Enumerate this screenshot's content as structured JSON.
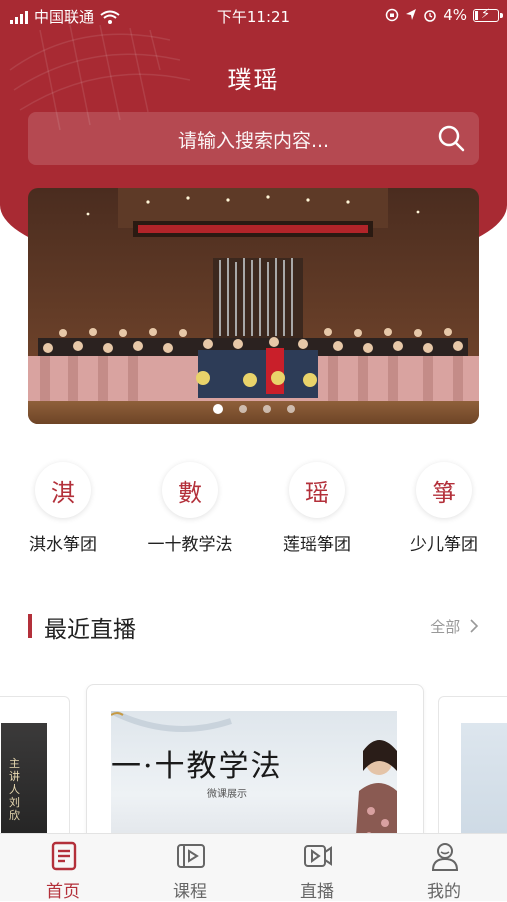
{
  "status_bar": {
    "carrier": "中国联通",
    "time": "下午11:21",
    "battery": "4%"
  },
  "header": {
    "title": "璞瑶"
  },
  "search": {
    "placeholder": "请输入搜索内容..."
  },
  "banner": {
    "slides": 4,
    "active_index": 0
  },
  "categories": [
    {
      "icon_char": "淇",
      "label": "淇水筝团"
    },
    {
      "icon_char": "數",
      "label": "一十教学法"
    },
    {
      "icon_char": "瑶",
      "label": "莲瑶筝团"
    },
    {
      "icon_char": "箏",
      "label": "少儿筝团"
    }
  ],
  "section": {
    "title": "最近直播",
    "more_label": "全部"
  },
  "live_cards": {
    "left_text": "主讲人刘欣",
    "main_title": "一·十教学法",
    "main_sub": "微课展示"
  },
  "tabbar": {
    "items": [
      {
        "label": "首页",
        "active": true
      },
      {
        "label": "课程",
        "active": false
      },
      {
        "label": "直播",
        "active": false
      },
      {
        "label": "我的",
        "active": false
      }
    ]
  },
  "colors": {
    "brand": "#a82a33",
    "accent": "#b3303a",
    "tab_inactive": "#666666"
  }
}
